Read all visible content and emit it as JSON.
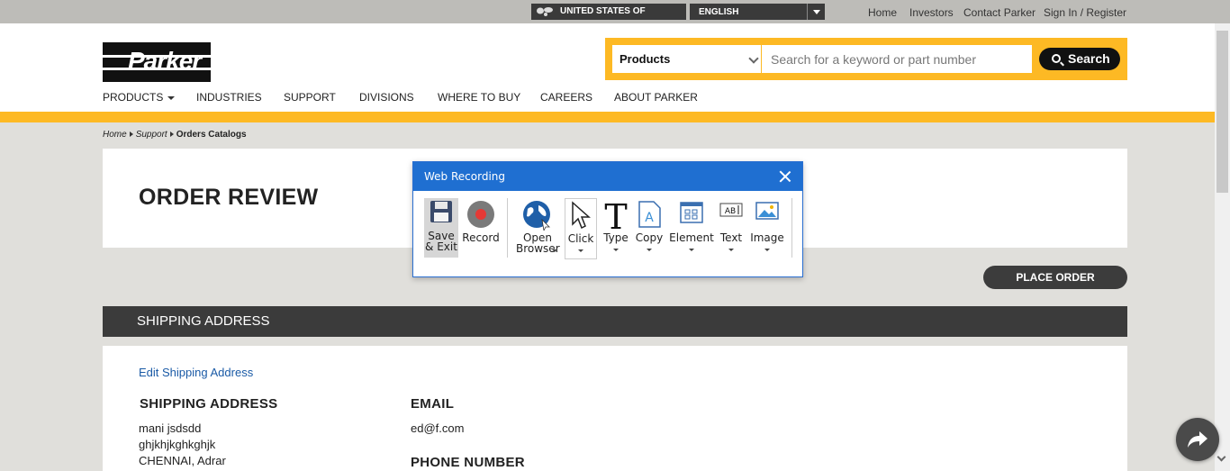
{
  "topbar": {
    "region": "UNITED STATES OF AMERICA",
    "language": "ENGLISH",
    "links": [
      "Home",
      "Investors",
      "Contact Parker",
      "Sign In / Register"
    ]
  },
  "header": {
    "logo": "Parker",
    "search": {
      "category": "Products",
      "placeholder": "Search for a keyword or part number",
      "button": "Search"
    },
    "nav": [
      "PRODUCTS",
      "INDUSTRIES",
      "SUPPORT",
      "DIVISIONS",
      "WHERE TO BUY",
      "CAREERS",
      "ABOUT PARKER"
    ]
  },
  "breadcrumb": [
    "Home",
    "Support",
    "Orders Catalogs"
  ],
  "page": {
    "title": "ORDER REVIEW",
    "place_order": "PLACE ORDER",
    "shipping_bar": "SHIPPING ADDRESS",
    "edit_link": "Edit Shipping Address",
    "address_heading": "SHIPPING ADDRESS",
    "address_lines": [
      "mani jsdsdd",
      "ghjkhjkghkghjk",
      "CHENNAI, Adrar"
    ],
    "email_heading": "EMAIL",
    "email": "ed@f.com",
    "phone_heading": "PHONE NUMBER"
  },
  "dialog": {
    "title": "Web Recording",
    "tools": {
      "save_exit": "Save\n& Exit",
      "record": "Record",
      "open_browser": "Open\nBrowser",
      "click": "Click",
      "type": "Type",
      "copy": "Copy",
      "element": "Element",
      "text": "Text",
      "image": "Image"
    }
  },
  "colors": {
    "brand_yellow": "#fdb924",
    "dialog_blue": "#1f6fd1",
    "record_red": "#e53935",
    "link_blue": "#1a5aa6"
  }
}
